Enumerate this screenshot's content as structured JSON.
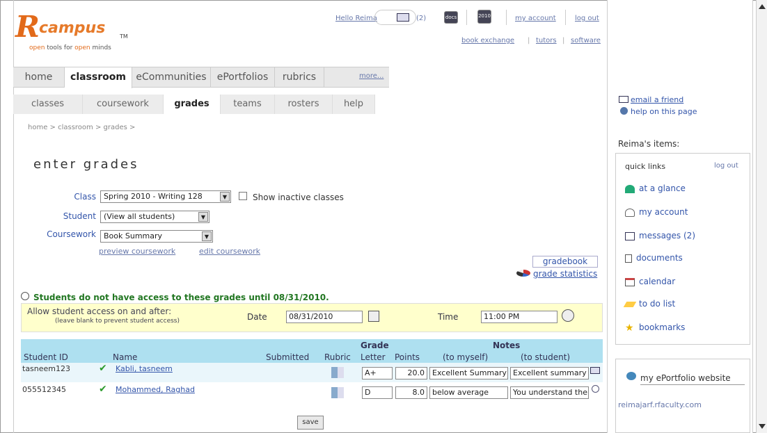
{
  "header": {
    "logo_r": "R",
    "logo_word": "campus",
    "logo_tm": "TM",
    "tagline_prefix": "open",
    "tagline_mid": " tools for ",
    "tagline_word": "open",
    "tagline_suffix": " minds",
    "hello": "Hello Reima",
    "messages_count": "(2)",
    "docs_label": "docs",
    "cal_label": "2010",
    "my_account": "my account",
    "log_out": "log out",
    "book_exchange": "book exchange",
    "tutors": "tutors",
    "software": "software"
  },
  "main_tabs": [
    "home",
    "classroom",
    "eCommunities",
    "ePortfolios",
    "rubrics"
  ],
  "more_link": "more...",
  "sub_tabs": [
    "classes",
    "coursework",
    "grades",
    "teams",
    "rosters",
    "help"
  ],
  "breadcrumb": "home > classroom > grades >",
  "page_title": "enter grades",
  "form": {
    "class_label": "Class",
    "class_value": "Spring 2010 - Writing 128",
    "show_inactive": "Show inactive classes",
    "student_label": "Student",
    "student_value": "(View all students)",
    "coursework_label": "Coursework",
    "coursework_value": "Book Summary",
    "preview_link": "preview coursework",
    "edit_link": "edit coursework",
    "gradebook_button": "gradebook",
    "grade_statistics": "grade statistics"
  },
  "notice": "Students do not have access to these grades until 08/31/2010.",
  "access": {
    "title": "Allow student access on and after:",
    "hint": "(leave blank to prevent student access)",
    "date_label": "Date",
    "date_value": "08/31/2010",
    "time_label": "Time",
    "time_value": "11:00 PM"
  },
  "table": {
    "header_grade": "Grade",
    "header_notes": "Notes",
    "columns": [
      "Student ID",
      "Name",
      "Submitted",
      "Rubric",
      "Letter",
      "Points",
      "(to myself)",
      "(to student)"
    ],
    "rows": [
      {
        "id": "tasneem123",
        "name": "Kabli, tasneem",
        "letter": "A+",
        "points": "20.0",
        "note_self": "Excellent Summary",
        "note_student": "Excellent summary"
      },
      {
        "id": "055512345",
        "name": "Mohammed, Raghad",
        "letter": "D",
        "points": "8.0",
        "note_self": "below average",
        "note_student": "You understand the"
      }
    ]
  },
  "save_button": "save",
  "sidebar": {
    "email_friend": "email a friend",
    "help_page": "help on this page",
    "items_title": "Reima's items:",
    "quick_links": "quick links",
    "log_out": "log out",
    "links": [
      "at a glance",
      "my account",
      "messages (2)",
      "documents",
      "calendar",
      "to do list",
      "bookmarks"
    ],
    "eportfolio_title": "my ePortfolio website",
    "eportfolio_url": "reimajarf.rfaculty.com"
  }
}
